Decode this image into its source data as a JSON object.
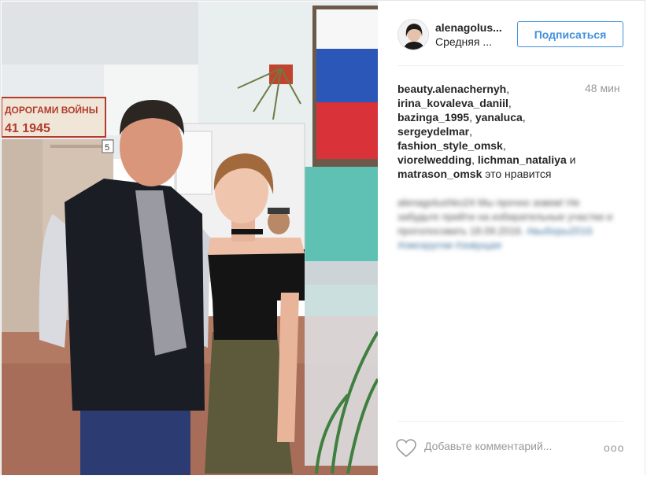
{
  "post": {
    "username": "alenagolus...",
    "location": "Средняя ...",
    "follow_label": "Подписаться",
    "time_ago": "48 мин",
    "likes": {
      "users": [
        "beauty.alenachernyh",
        "irina_kovaleva_daniil",
        "bazinga_1995",
        "yanaluca",
        "sergeydelmar",
        "fashion_style_omsk",
        "viorelwedding",
        "lichman_nataliya",
        "matrason_omsk"
      ],
      "and_word": "и",
      "suffix": "это нравится"
    },
    "add_comment_placeholder": "Добавьте комментарий...",
    "more_label": "ooo",
    "photo_poster": {
      "line1": "ДОРОГАМИ ВОЙНЫ",
      "line2": "41  1945",
      "booth_number": "5"
    }
  },
  "colors": {
    "accent": "#4090db",
    "text": "#262626",
    "muted": "#999999",
    "tag": "#3f729b"
  },
  "icons": [
    "heart-icon",
    "more-options-icon"
  ]
}
